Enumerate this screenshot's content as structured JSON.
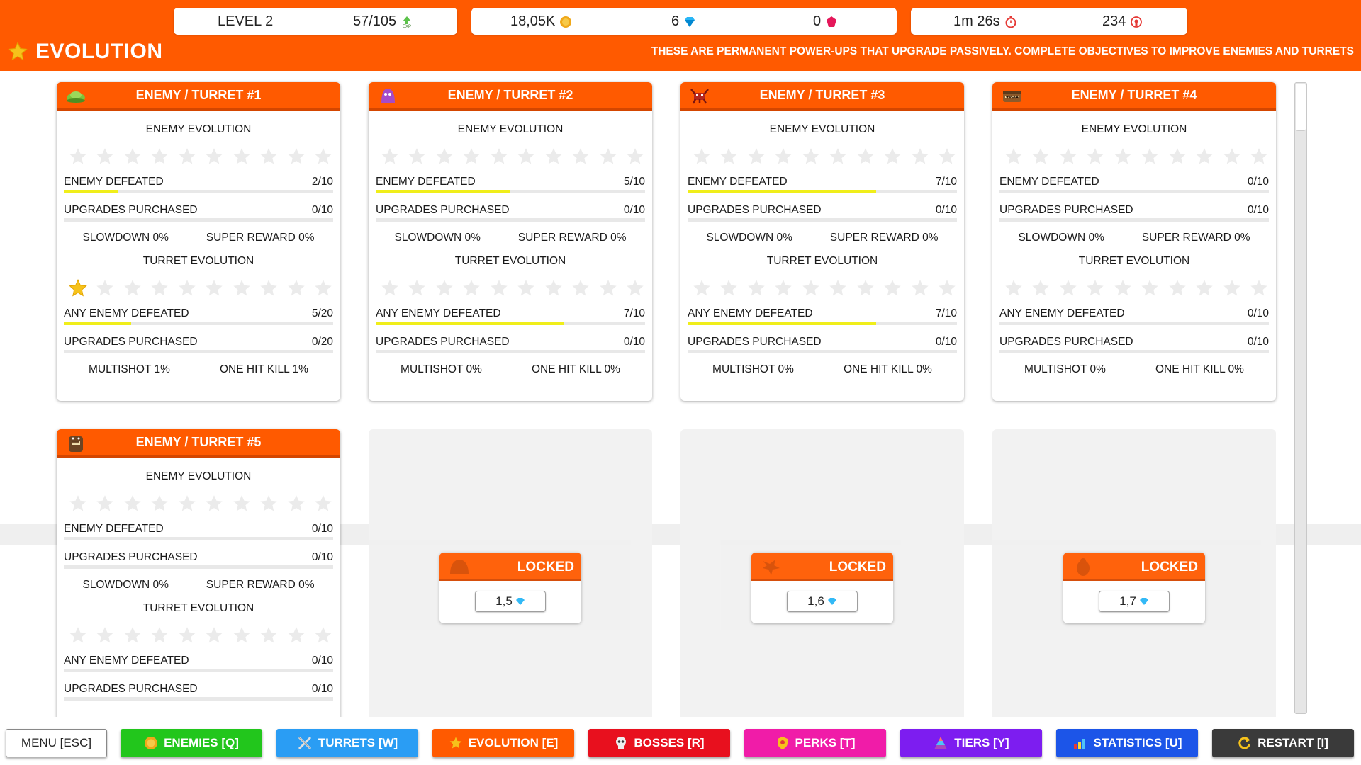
{
  "header": {
    "level_label": "LEVEL 2",
    "exp_value": "57/105",
    "exp_icon": "exp-arrow-icon",
    "coins": "18,05K",
    "gems": "6",
    "rubies": "0",
    "time": "1m 26s",
    "kills": "234",
    "title": "EVOLUTION",
    "subtitle": "THESE ARE PERMANENT POWER-UPS THAT UPGRADE PASSIVELY. COMPLETE OBJECTIVES TO IMPROVE ENEMIES AND TURRETS"
  },
  "labels": {
    "enemy_evolution": "ENEMY EVOLUTION",
    "turret_evolution": "TURRET EVOLUTION",
    "enemy_defeated": "ENEMY DEFEATED",
    "any_enemy_defeated": "ANY ENEMY DEFEATED",
    "upgrades_purchased": "UPGRADES PURCHASED",
    "locked": "LOCKED"
  },
  "cards": [
    {
      "title": "ENEMY  /  TURRET #1",
      "icon": "green-blob-enemy-icon",
      "enemy_stars": 0,
      "enemy_defeated": "2/10",
      "enemy_defeated_progress": 0.2,
      "enemy_upgrades": "0/10",
      "enemy_upgrades_progress": 0,
      "slowdown": "SLOWDOWN 0%",
      "super_reward": "SUPER REWARD 0%",
      "turret_stars": 1,
      "any_defeated": "5/20",
      "any_defeated_progress": 0.25,
      "turret_upgrades": "0/20",
      "turret_upgrades_progress": 0,
      "multishot": "MULTISHOT 1%",
      "one_hit_kill": "ONE HIT KILL 1%"
    },
    {
      "title": "ENEMY  /  TURRET #2",
      "icon": "purple-ghost-enemy-icon",
      "enemy_stars": 0,
      "enemy_defeated": "5/10",
      "enemy_defeated_progress": 0.5,
      "enemy_upgrades": "0/10",
      "enemy_upgrades_progress": 0,
      "slowdown": "SLOWDOWN 0%",
      "super_reward": "SUPER REWARD 0%",
      "turret_stars": 0,
      "any_defeated": "7/10",
      "any_defeated_progress": 0.7,
      "turret_upgrades": "0/10",
      "turret_upgrades_progress": 0,
      "multishot": "MULTISHOT 0%",
      "one_hit_kill": "ONE HIT KILL 0%"
    },
    {
      "title": "ENEMY  /  TURRET #3",
      "icon": "red-crab-enemy-icon",
      "enemy_stars": 0,
      "enemy_defeated": "7/10",
      "enemy_defeated_progress": 0.7,
      "enemy_upgrades": "0/10",
      "enemy_upgrades_progress": 0,
      "slowdown": "SLOWDOWN 0%",
      "super_reward": "SUPER REWARD 0%",
      "turret_stars": 0,
      "any_defeated": "7/10",
      "any_defeated_progress": 0.7,
      "turret_upgrades": "0/10",
      "turret_upgrades_progress": 0,
      "multishot": "MULTISHOT 0%",
      "one_hit_kill": "ONE HIT KILL 0%"
    },
    {
      "title": "ENEMY  /  TURRET #4",
      "icon": "brown-chest-enemy-icon",
      "enemy_stars": 0,
      "enemy_defeated": "0/10",
      "enemy_defeated_progress": 0,
      "enemy_upgrades": "0/10",
      "enemy_upgrades_progress": 0,
      "slowdown": "SLOWDOWN 0%",
      "super_reward": "SUPER REWARD 0%",
      "turret_stars": 0,
      "any_defeated": "0/10",
      "any_defeated_progress": 0,
      "turret_upgrades": "0/10",
      "turret_upgrades_progress": 0,
      "multishot": "MULTISHOT 0%",
      "one_hit_kill": "ONE HIT KILL 0%"
    },
    {
      "title": "ENEMY  /  TURRET #5",
      "icon": "brown-barrel-enemy-icon",
      "enemy_stars": 0,
      "enemy_defeated": "0/10",
      "enemy_defeated_progress": 0,
      "enemy_upgrades": "0/10",
      "enemy_upgrades_progress": 0,
      "slowdown": "SLOWDOWN 0%",
      "super_reward": "SUPER REWARD 0%",
      "turret_stars": 0,
      "any_defeated": "0/10",
      "any_defeated_progress": 0,
      "turret_upgrades": "0/10",
      "turret_upgrades_progress": 0,
      "multishot": "",
      "one_hit_kill": ""
    }
  ],
  "locked": [
    {
      "price": "1,5",
      "icon": "orange-blob-silhouette-icon"
    },
    {
      "price": "1,6",
      "icon": "orange-bird-silhouette-icon"
    },
    {
      "price": "1,7",
      "icon": "orange-figure-silhouette-icon"
    }
  ],
  "nav": {
    "menu": "MENU [ESC]",
    "enemies": "ENEMIES [Q]",
    "turrets": "TURRETS [W]",
    "evolution": "EVOLUTION [E]",
    "bosses": "BOSSES [R]",
    "perks": "PERKS [T]",
    "tiers": "TIERS [Y]",
    "statistics": "STATISTICS [U]",
    "restart": "RESTART [I]"
  },
  "colors": {
    "accent": "#ff5a00",
    "progress": "#f0ee1a",
    "enemies_btn": "#22c61c",
    "turrets_btn": "#2a9df4",
    "evolution_btn": "#ff5a00",
    "bosses_btn": "#e8101e",
    "perks_btn": "#f01ca8",
    "tiers_btn": "#7d1df0",
    "statistics_btn": "#1c55e8",
    "restart_btn": "#3a3a3a"
  }
}
